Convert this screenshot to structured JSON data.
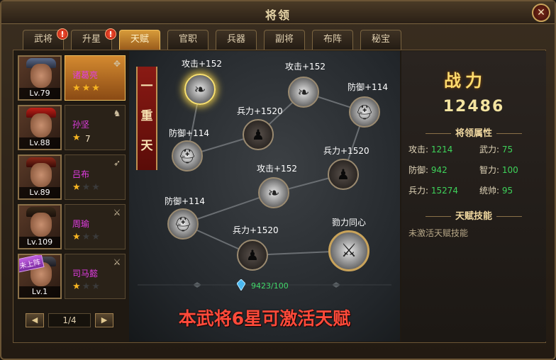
{
  "window": {
    "title": "将领",
    "close_glyph": "✕"
  },
  "tabs": [
    {
      "label": "武将",
      "alert": "!"
    },
    {
      "label": "升星",
      "alert": "!"
    },
    {
      "label": "天赋",
      "active": true
    },
    {
      "label": "官职"
    },
    {
      "label": "兵器"
    },
    {
      "label": "副将"
    },
    {
      "label": "布阵"
    },
    {
      "label": "秘宝"
    }
  ],
  "heroes": [
    {
      "name": "诸葛亮",
      "level": "Lv.79",
      "stars": 3,
      "selected": true,
      "icon": "fan-icon"
    },
    {
      "name": "孙坚",
      "level": "Lv.88",
      "star_count": "7",
      "icon": "horse-icon"
    },
    {
      "name": "吕布",
      "level": "Lv.89",
      "stars": 1,
      "icon": "spear-icon"
    },
    {
      "name": "周瑜",
      "level": "Lv.109",
      "stars": 1,
      "icon": "sword-icon"
    },
    {
      "name": "司马懿",
      "level": "Lv.1",
      "stars": 1,
      "banner": "未上阵",
      "icon": "sword-icon"
    }
  ],
  "pager": {
    "text": "1/4",
    "prev": "◀",
    "next": "▶"
  },
  "talent": {
    "layer_label": [
      "一",
      "重",
      "天"
    ],
    "nodes": [
      {
        "label": "攻击+152"
      },
      {
        "label": "攻击+152"
      },
      {
        "label": "防御+114"
      },
      {
        "label": "兵力+1520"
      },
      {
        "label": "防御+114"
      },
      {
        "label": "兵力+1520"
      },
      {
        "label": "攻击+152"
      },
      {
        "label": "防御+114"
      },
      {
        "label": "兵力+1520"
      },
      {
        "label": "勠力同心"
      }
    ],
    "resource": "9423/100",
    "activate_hint": "本武将6星可激活天赋"
  },
  "stats": {
    "power_label": "战力",
    "power_value": "12486",
    "section_title": "将领属性",
    "attributes": [
      {
        "key": "攻击:",
        "value": "1214"
      },
      {
        "key": "武力:",
        "value": "75"
      },
      {
        "key": "防御:",
        "value": "942"
      },
      {
        "key": "智力:",
        "value": "100"
      },
      {
        "key": "兵力:",
        "value": "15274"
      },
      {
        "key": "统帅:",
        "value": "95"
      }
    ],
    "skill_title": "天赋技能",
    "skill_text": "未激活天赋技能"
  },
  "colors": {
    "accent_orange": "#d48a30",
    "value_green": "#3ed25a",
    "hint_red": "#ff4a3a",
    "name_purple": "#e23ce2",
    "star_gold": "#f5b422"
  }
}
